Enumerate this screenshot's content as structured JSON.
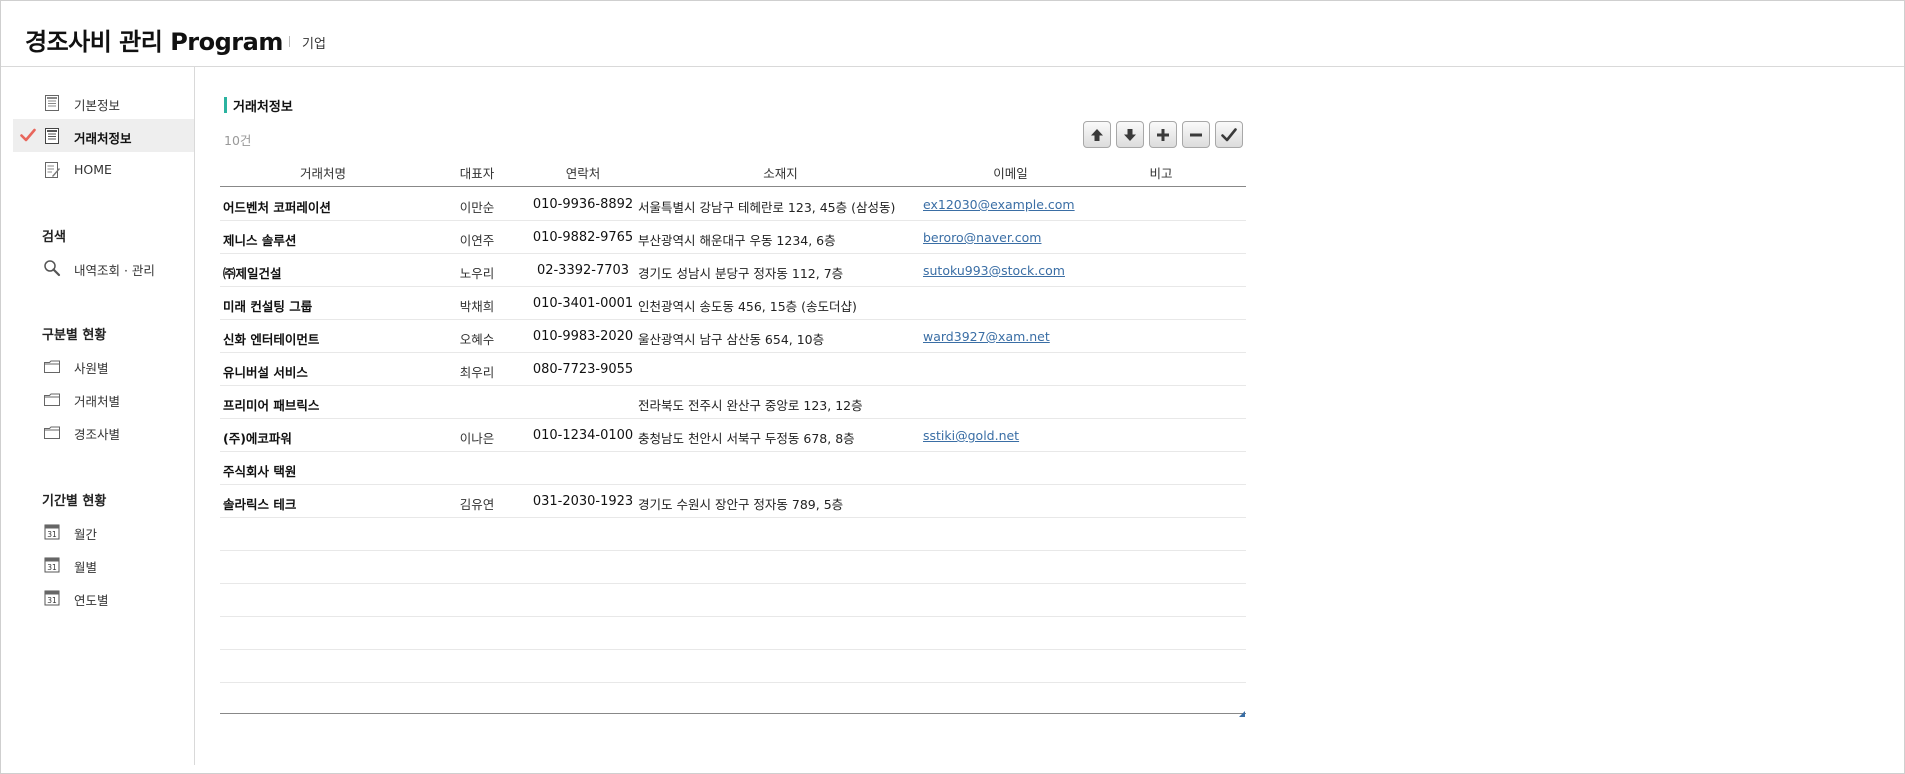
{
  "header": {
    "title": "경조사비 관리 Program",
    "subtitle": "기업"
  },
  "sidebar": {
    "top_items": [
      {
        "label": "기본정보",
        "icon": "document-icon",
        "active": false
      },
      {
        "label": "거래처정보",
        "icon": "document-icon",
        "active": true
      },
      {
        "label": "HOME",
        "icon": "edit-document-icon",
        "active": false
      }
    ],
    "sections": [
      {
        "title": "검색",
        "items": [
          {
            "label": "내역조회 · 관리",
            "icon": "search-icon"
          }
        ]
      },
      {
        "title": "구분별 현황",
        "items": [
          {
            "label": "사원별",
            "icon": "folder-icon"
          },
          {
            "label": "거래처별",
            "icon": "folder-icon"
          },
          {
            "label": "경조사별",
            "icon": "folder-icon"
          }
        ]
      },
      {
        "title": "기간별 현황",
        "items": [
          {
            "label": "월간",
            "icon": "calendar-icon"
          },
          {
            "label": "월별",
            "icon": "calendar-icon"
          },
          {
            "label": "연도별",
            "icon": "calendar-icon"
          }
        ]
      }
    ],
    "calendar_icon_text": "31"
  },
  "main": {
    "title": "거래처정보",
    "count": "10건",
    "toolbar": [
      {
        "name": "move-up-button",
        "icon": "arrow-up-icon"
      },
      {
        "name": "move-down-button",
        "icon": "arrow-down-icon"
      },
      {
        "name": "add-row-button",
        "icon": "plus-icon"
      },
      {
        "name": "remove-row-button",
        "icon": "minus-icon"
      },
      {
        "name": "confirm-button",
        "icon": "check-icon"
      }
    ],
    "columns": [
      "거래처명",
      "대표자",
      "연락처",
      "소재지",
      "이메일",
      "비고"
    ],
    "rows": [
      {
        "name": "어드벤처 코퍼레이션",
        "rep": "이만순",
        "phone": "010-9936-8892",
        "addr": "서울특별시 강남구 테헤란로 123, 45층 (삼성동)",
        "email": "ex12030@example.com",
        "note": ""
      },
      {
        "name": "제니스 솔루션",
        "rep": "이연주",
        "phone": "010-9882-9765",
        "addr": "부산광역시 해운대구 우동 1234, 6층",
        "email": "beroro@naver.com",
        "note": ""
      },
      {
        "name": "㈜제일건설",
        "rep": "노우리",
        "phone": "02-3392-7703",
        "addr": "경기도 성남시 분당구 정자동 112, 7층",
        "email": "sutoku993@stock.com",
        "note": ""
      },
      {
        "name": "미래 컨설팅 그룹",
        "rep": "박채희",
        "phone": "010-3401-0001",
        "addr": "인천광역시 송도동 456, 15층 (송도더샵)",
        "email": "",
        "note": ""
      },
      {
        "name": "신화 엔터테이먼트",
        "rep": "오혜수",
        "phone": "010-9983-2020",
        "addr": "울산광역시 남구 삼산동 654, 10층",
        "email": "ward3927@xam.net",
        "note": ""
      },
      {
        "name": "유니버설 서비스",
        "rep": "최우리",
        "phone": "080-7723-9055",
        "addr": "",
        "email": "",
        "note": ""
      },
      {
        "name": "프리미어 패브릭스",
        "rep": "",
        "phone": "",
        "addr": "전라북도 전주시 완산구 중앙로 123, 12층",
        "email": "",
        "note": ""
      },
      {
        "name": "(주)에코파워",
        "rep": "이나은",
        "phone": "010-1234-0100",
        "addr": "충청남도 천안시 서북구 두정동 678, 8층",
        "email": "sstiki@gold.net",
        "note": ""
      },
      {
        "name": "주식회사 택원",
        "rep": "",
        "phone": "",
        "addr": "",
        "email": "",
        "note": ""
      },
      {
        "name": "솔라릭스 테크",
        "rep": "김유연",
        "phone": "031-2030-1923",
        "addr": "경기도 수원시 장안구 정자동 789, 5층",
        "email": "",
        "note": ""
      }
    ],
    "empty_rows": 6
  },
  "colors": {
    "accent": "#2bb3a0",
    "check": "#e8665c",
    "link": "#3a6ea5",
    "active_bg": "#eeeeee"
  }
}
